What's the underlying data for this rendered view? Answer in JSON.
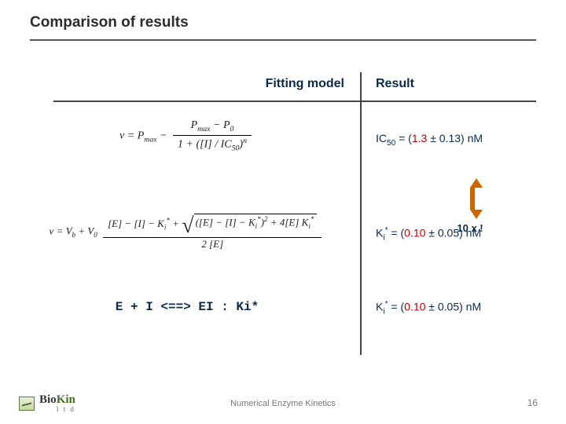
{
  "title": "Comparison of results",
  "headers": {
    "left": "Fitting model",
    "right": "Result"
  },
  "row1": {
    "eq": {
      "lhs": "v = P",
      "lhs_sub": "max",
      "minus": " − ",
      "num_a": "P",
      "num_a_sub": "max",
      "num_minus": " − ",
      "num_b": "P",
      "num_b_sub": "0",
      "den_prefix": "1 + ([I] / IC",
      "den_sub": "50",
      "den_suffix": ")",
      "den_sup": "n"
    },
    "result": {
      "sym": "IC",
      "sym_sub": "50",
      "eq": " = (",
      "val": "1.3",
      "pm": " ± 0.13) nM"
    }
  },
  "callout": {
    "text": "10 x !"
  },
  "row2": {
    "eq": {
      "lhs": "v = V",
      "lhs_b_sub": "b",
      "plus": " + V",
      "lhs_0_sub": "0",
      "sp": " ",
      "num_open": "[E] − [I] − K",
      "num_ki_sub": "i",
      "num_ki_sup": "*",
      "num_plus": " + ",
      "sqrt_open": "([E] − [I] − K",
      "sqrt_ki_sub": "i",
      "sqrt_ki_sup": "*",
      "sqrt_close": ")",
      "sqrt_pow": "2",
      "sqrt_tail": " + 4[E] K",
      "sqrt_t_sub": "i",
      "sqrt_t_sup": "*",
      "den": "2 [E]"
    },
    "result": {
      "sym": "K",
      "sym_sub": "i",
      "sym_sup": "*",
      "eq": " = (",
      "val": "0.10",
      "pm": " ± 0.05) nM"
    }
  },
  "row3": {
    "scheme": "E + I <==> EI   :   Ki*",
    "result": {
      "sym": "K",
      "sym_sub": "i",
      "sym_sup": "*",
      "eq": " = (",
      "val": "0.10",
      "pm": " ± 0.05) nM"
    }
  },
  "footer": {
    "brand_a": "Bio",
    "brand_b": "Kin",
    "ltd": "l t d",
    "center": "Numerical Enzyme Kinetics",
    "page": "16"
  }
}
